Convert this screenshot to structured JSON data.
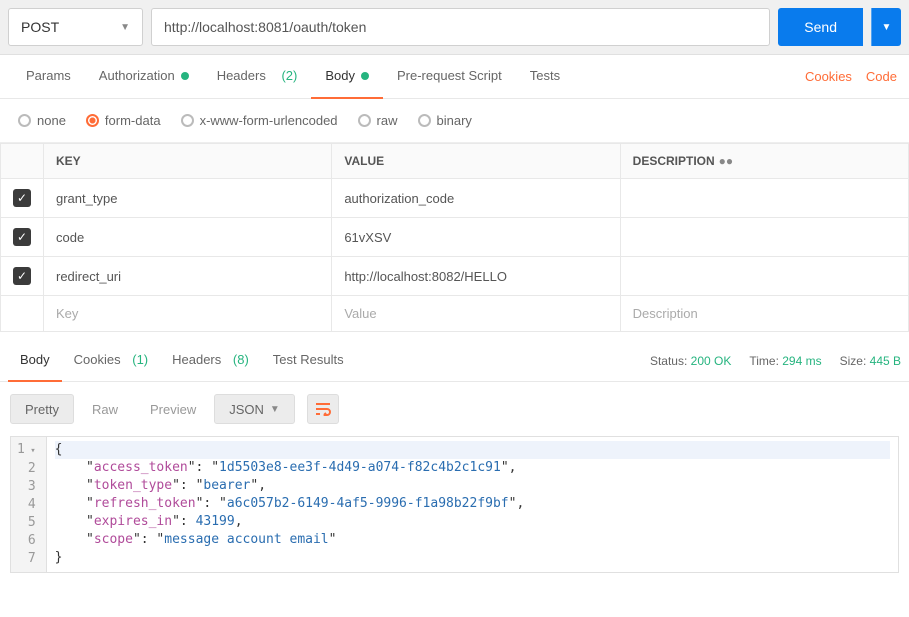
{
  "request": {
    "method": "POST",
    "url": "http://localhost:8081/oauth/token",
    "send_label": "Send"
  },
  "tabs": {
    "params": "Params",
    "authorization": "Authorization",
    "headers": "Headers",
    "headers_count": "(2)",
    "body": "Body",
    "prerequest": "Pre-request Script",
    "tests": "Tests"
  },
  "right_links": {
    "cookies": "Cookies",
    "code": "Code"
  },
  "body_types": {
    "none": "none",
    "formdata": "form-data",
    "urlencoded": "x-www-form-urlencoded",
    "raw": "raw",
    "binary": "binary"
  },
  "kv": {
    "headers": {
      "key": "KEY",
      "value": "VALUE",
      "desc": "DESCRIPTION"
    },
    "rows": [
      {
        "key": "grant_type",
        "value": "authorization_code"
      },
      {
        "key": "code",
        "value": "61vXSV"
      },
      {
        "key": "redirect_uri",
        "value": "http://localhost:8082/HELLO"
      }
    ],
    "placeholder": {
      "key": "Key",
      "value": "Value",
      "desc": "Description"
    }
  },
  "response": {
    "tabs": {
      "body": "Body",
      "cookies": "Cookies",
      "cookies_count": "(1)",
      "headers": "Headers",
      "headers_count": "(8)",
      "tests": "Test Results"
    },
    "status_label": "Status:",
    "status_value": "200 OK",
    "time_label": "Time:",
    "time_value": "294 ms",
    "size_label": "Size:",
    "size_value": "445 B",
    "viewer": {
      "pretty": "Pretty",
      "raw": "Raw",
      "preview": "Preview",
      "format": "JSON"
    },
    "json": {
      "l1": "{",
      "l2a": "    \"",
      "l2k": "access_token",
      "l2b": "\": \"",
      "l2v": "1d5503e8-ee3f-4d49-a074-f82c4b2c1c91",
      "l2c": "\",",
      "l3a": "    \"",
      "l3k": "token_type",
      "l3b": "\": \"",
      "l3v": "bearer",
      "l3c": "\",",
      "l4a": "    \"",
      "l4k": "refresh_token",
      "l4b": "\": \"",
      "l4v": "a6c057b2-6149-4af5-9996-f1a98b22f9bf",
      "l4c": "\",",
      "l5a": "    \"",
      "l5k": "expires_in",
      "l5b": "\": ",
      "l5v": "43199",
      "l5c": ",",
      "l6a": "    \"",
      "l6k": "scope",
      "l6b": "\": \"",
      "l6v": "message account email",
      "l6c": "\"",
      "l7": "}"
    }
  }
}
